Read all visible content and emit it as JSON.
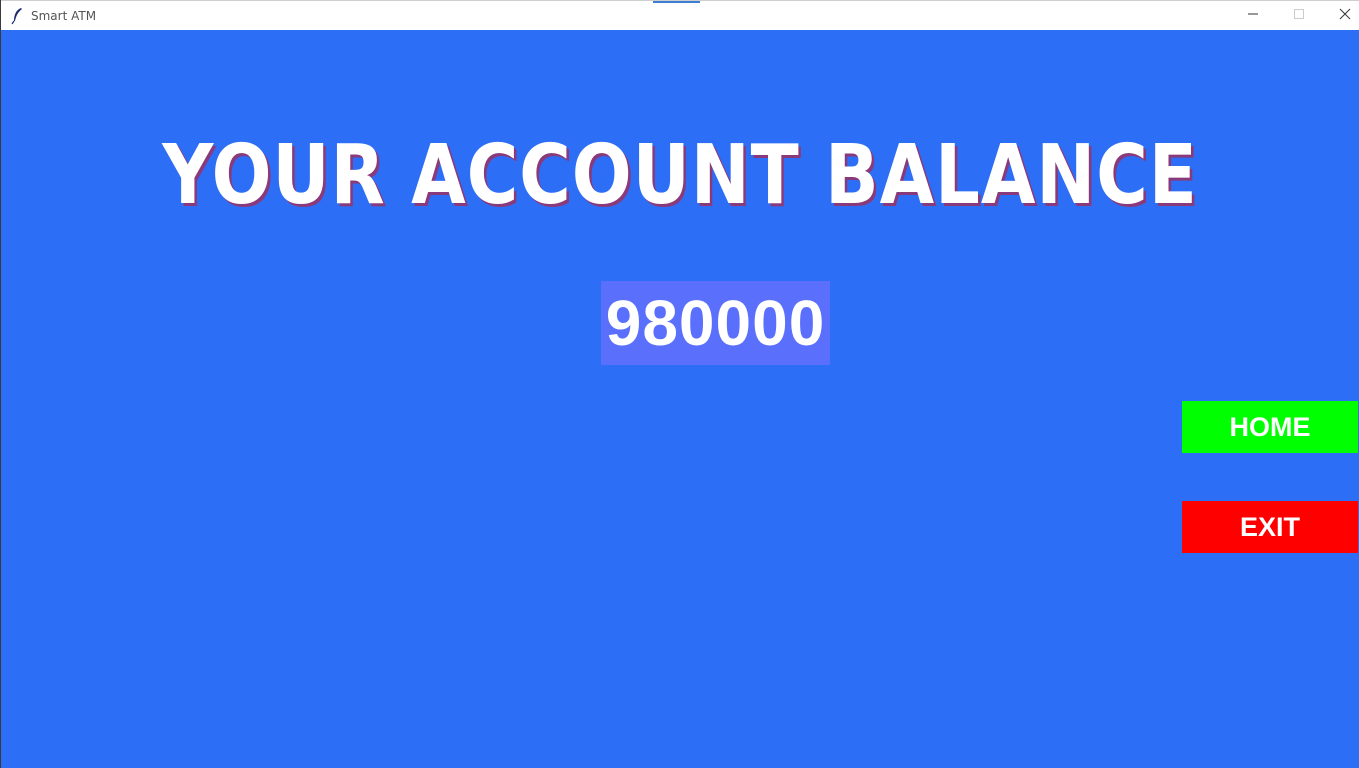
{
  "window": {
    "title": "Smart ATM",
    "controls": {
      "minimize_icon": "minimize-icon",
      "maximize_icon": "maximize-icon",
      "close_icon": "close-icon"
    }
  },
  "screen": {
    "heading": "YOUR ACCOUNT BALANCE",
    "balance": "980000",
    "background_color": "#2d6ef7",
    "balance_box_color": "#5b6ffd"
  },
  "buttons": {
    "home": {
      "label": "HOME",
      "color": "#00ff00"
    },
    "exit": {
      "label": "EXIT",
      "color": "#ff0000"
    }
  }
}
